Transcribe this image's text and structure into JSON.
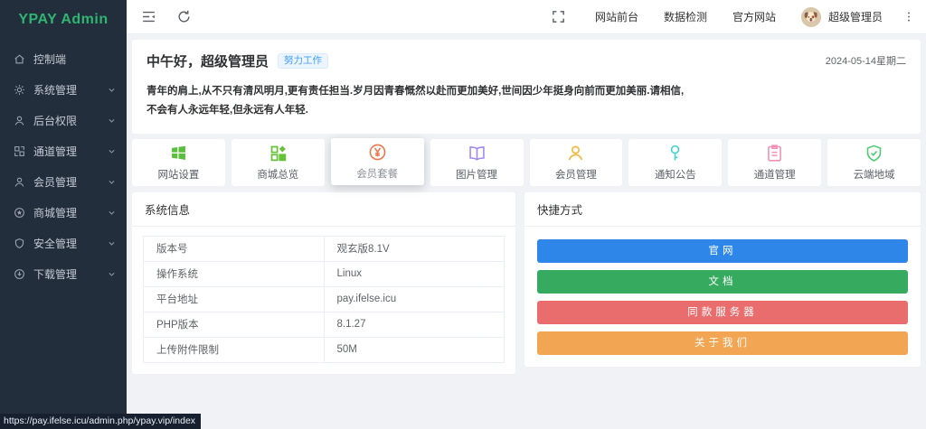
{
  "app": {
    "title": "YPAY Admin"
  },
  "sidebar": {
    "items": [
      {
        "label": "控制端"
      },
      {
        "label": "系统管理"
      },
      {
        "label": "后台权限"
      },
      {
        "label": "通道管理"
      },
      {
        "label": "会员管理"
      },
      {
        "label": "商城管理"
      },
      {
        "label": "安全管理"
      },
      {
        "label": "下载管理"
      }
    ]
  },
  "header": {
    "links": [
      {
        "label": "网站前台"
      },
      {
        "label": "数据检测"
      },
      {
        "label": "官方网站"
      }
    ],
    "user": {
      "name": "超级管理员",
      "avatar_icon": "dog-avatar",
      "avatar_glyph": "🐶"
    }
  },
  "greeting": {
    "title": "中午好，超级管理员",
    "badge": "努力工作",
    "date": "2024-05-14星期二",
    "quote": "青年的肩上,从不只有清风明月,更有责任担当.岁月因青春慨然以赴而更加美好,世间因少年挺身向前而更加美丽.请相信,不会有人永远年轻,但永远有人年轻."
  },
  "feature_cards": [
    {
      "label": "网站设置",
      "icon": "windows-grid-icon",
      "color": "#5abf3c"
    },
    {
      "label": "商城总览",
      "icon": "app-grid-icon",
      "color": "#67c23a"
    },
    {
      "label": "会员套餐",
      "icon": "yen-circle-icon",
      "color": "#f0764a",
      "raised": true
    },
    {
      "label": "图片管理",
      "icon": "book-icon",
      "color": "#a287f4"
    },
    {
      "label": "会员管理",
      "icon": "person-icon",
      "color": "#f3ba3f"
    },
    {
      "label": "通知公告",
      "icon": "key-icon",
      "color": "#40d1cd"
    },
    {
      "label": "通道管理",
      "icon": "clipboard-icon",
      "color": "#f391b5"
    },
    {
      "label": "云端地域",
      "icon": "shield-check-icon",
      "color": "#4ecb73"
    }
  ],
  "system_info": {
    "title": "系统信息",
    "rows": [
      {
        "label": "版本号",
        "value": "观玄版8.1V"
      },
      {
        "label": "操作系统",
        "value": "Linux"
      },
      {
        "label": "平台地址",
        "value": "pay.ifelse.icu"
      },
      {
        "label": "PHP版本",
        "value": "8.1.27"
      },
      {
        "label": "上传附件限制",
        "value": "50M"
      }
    ]
  },
  "quick_links": {
    "title": "快捷方式",
    "buttons": [
      {
        "label": "官网",
        "color": "#2e86e8"
      },
      {
        "label": "文档",
        "color": "#36ab60"
      },
      {
        "label": "同款服务器",
        "color": "#e96d6d"
      },
      {
        "label": "关于我们",
        "color": "#f2a654"
      }
    ]
  },
  "statusbar": {
    "url": "https://pay.ifelse.icu/admin.php/ypay.vip/index"
  },
  "colors": {
    "brand_green": "#2eb56f",
    "sidebar_bg": "#232e3d",
    "badge_blue": "#409eff",
    "page_bg": "#f0f2f5"
  }
}
